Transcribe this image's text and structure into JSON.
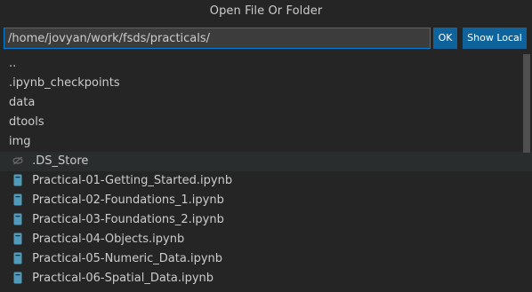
{
  "dialog": {
    "title": "Open File Or Folder",
    "path_value": "/home/jovyan/work/fsds/practicals/",
    "ok_label": "OK",
    "show_local_label": "Show Local"
  },
  "entries": [
    {
      "label": "..",
      "kind": "folder"
    },
    {
      "label": ".ipynb_checkpoints",
      "kind": "folder"
    },
    {
      "label": "data",
      "kind": "folder"
    },
    {
      "label": "dtools",
      "kind": "folder"
    },
    {
      "label": "img",
      "kind": "folder"
    },
    {
      "label": ".DS_Store",
      "kind": "hidden-file",
      "icon": "eye-slash-icon"
    },
    {
      "label": "Practical-01-Getting_Started.ipynb",
      "kind": "file",
      "icon": "notebook-icon"
    },
    {
      "label": "Practical-02-Foundations_1.ipynb",
      "kind": "file",
      "icon": "notebook-icon"
    },
    {
      "label": "Practical-03-Foundations_2.ipynb",
      "kind": "file",
      "icon": "notebook-icon"
    },
    {
      "label": "Practical-04-Objects.ipynb",
      "kind": "file",
      "icon": "notebook-icon"
    },
    {
      "label": "Practical-05-Numeric_Data.ipynb",
      "kind": "file",
      "icon": "notebook-icon"
    },
    {
      "label": "Practical-06-Spatial_Data.ipynb",
      "kind": "file",
      "icon": "notebook-icon"
    }
  ],
  "colors": {
    "accent": "#0e639c",
    "focus_border": "#007fd4",
    "notebook_icon": "#519aba",
    "background": "#252526"
  }
}
